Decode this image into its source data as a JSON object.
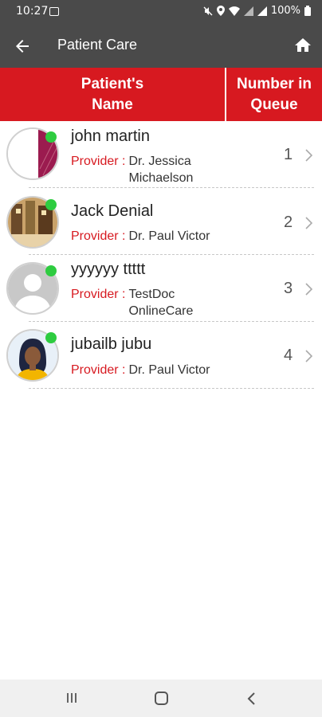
{
  "status_bar": {
    "time": "10:27",
    "battery": "100%"
  },
  "app_bar": {
    "title": "Patient Care"
  },
  "table_header": {
    "name_column": "Patient's\nName",
    "queue_column": "Number in\nQueue"
  },
  "provider_label": "Provider :",
  "patients": [
    {
      "name": "john martin",
      "provider": "Dr. Jessica Michaelson",
      "queue": "1"
    },
    {
      "name": "Jack Denial",
      "provider": "Dr. Paul Victor",
      "queue": "2"
    },
    {
      "name": "yyyyyy ttttt",
      "provider": "TestDoc OnlineCare",
      "queue": "3"
    },
    {
      "name": "jubailb jubu",
      "provider": "Dr. Paul Victor",
      "queue": "4"
    }
  ],
  "colors": {
    "header_red": "#d71920",
    "app_bar": "#4a4a4a",
    "online": "#2ecc40"
  }
}
